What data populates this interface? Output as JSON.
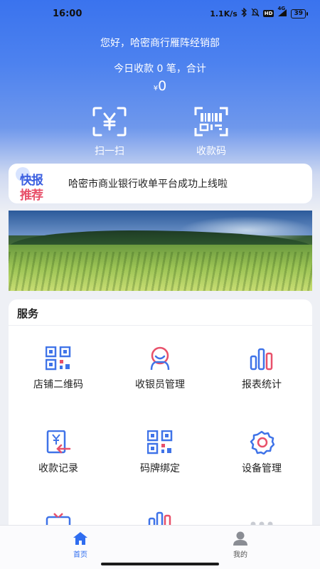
{
  "status_bar": {
    "time": "16:00",
    "network_speed": "1.1K/s",
    "network_type": "4G",
    "battery": "39",
    "hd_label": "HD"
  },
  "header": {
    "greeting": "您好，哈密商行雁阵经销部",
    "today_summary": "今日收款 0 笔，合计",
    "currency_symbol": "¥",
    "amount": "0"
  },
  "quick_actions": [
    {
      "label": "扫一扫",
      "icon": "scan-yuan-icon"
    },
    {
      "label": "收款码",
      "icon": "payment-code-icon"
    }
  ],
  "news": {
    "badge_line1": "快报",
    "badge_line2": "推荐",
    "text": "哈密市商业银行收单平台成功上线啦"
  },
  "banner": {
    "icon": "landscape-banner-image"
  },
  "services": {
    "title": "服务",
    "items": [
      {
        "label": "店铺二维码",
        "icon": "qr-code-icon"
      },
      {
        "label": "收银员管理",
        "icon": "cashier-user-icon"
      },
      {
        "label": "报表统计",
        "icon": "bar-chart-icon"
      },
      {
        "label": "收款记录",
        "icon": "payment-record-icon"
      },
      {
        "label": "码牌绑定",
        "icon": "qr-bind-icon"
      },
      {
        "label": "设备管理",
        "icon": "gear-icon"
      }
    ]
  },
  "tabbar": {
    "items": [
      {
        "label": "首页",
        "icon": "home-icon",
        "active": true
      },
      {
        "label": "我的",
        "icon": "user-icon",
        "active": false
      }
    ]
  },
  "colors": {
    "accent": "#2f6df0",
    "accent_red": "#e8506a",
    "hero_top": "#3a73ee"
  }
}
